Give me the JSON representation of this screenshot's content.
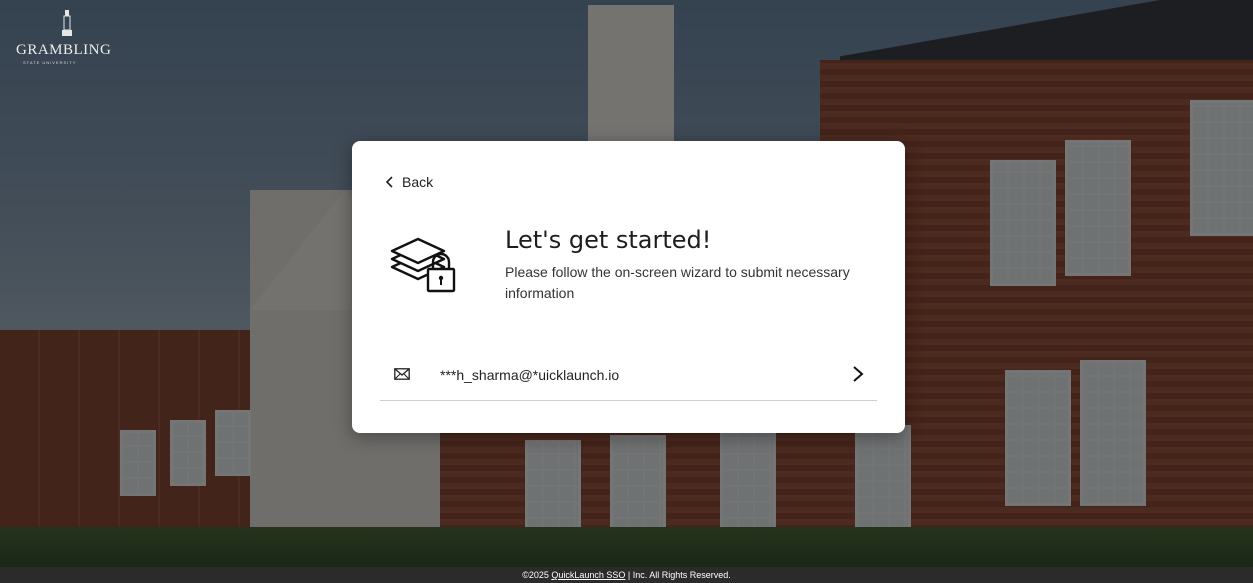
{
  "brand": {
    "logo_text": "GRAMBLING",
    "logo_subtext": "STATE UNIVERSITY"
  },
  "card": {
    "back_label": "Back",
    "title": "Let's get started!",
    "subtitle": "Please follow the on-screen wizard to submit necessary information",
    "hero_icon": "layers-lock-icon",
    "option": {
      "icon": "mail-icon",
      "email": "***h_sharma@*uicklaunch.io",
      "arrow_icon": "chevron-right-icon"
    }
  },
  "footer": {
    "prefix": "©2025 ",
    "link_text": "QuickLaunch SSO",
    "suffix": " | Inc. All Rights Reserved."
  }
}
